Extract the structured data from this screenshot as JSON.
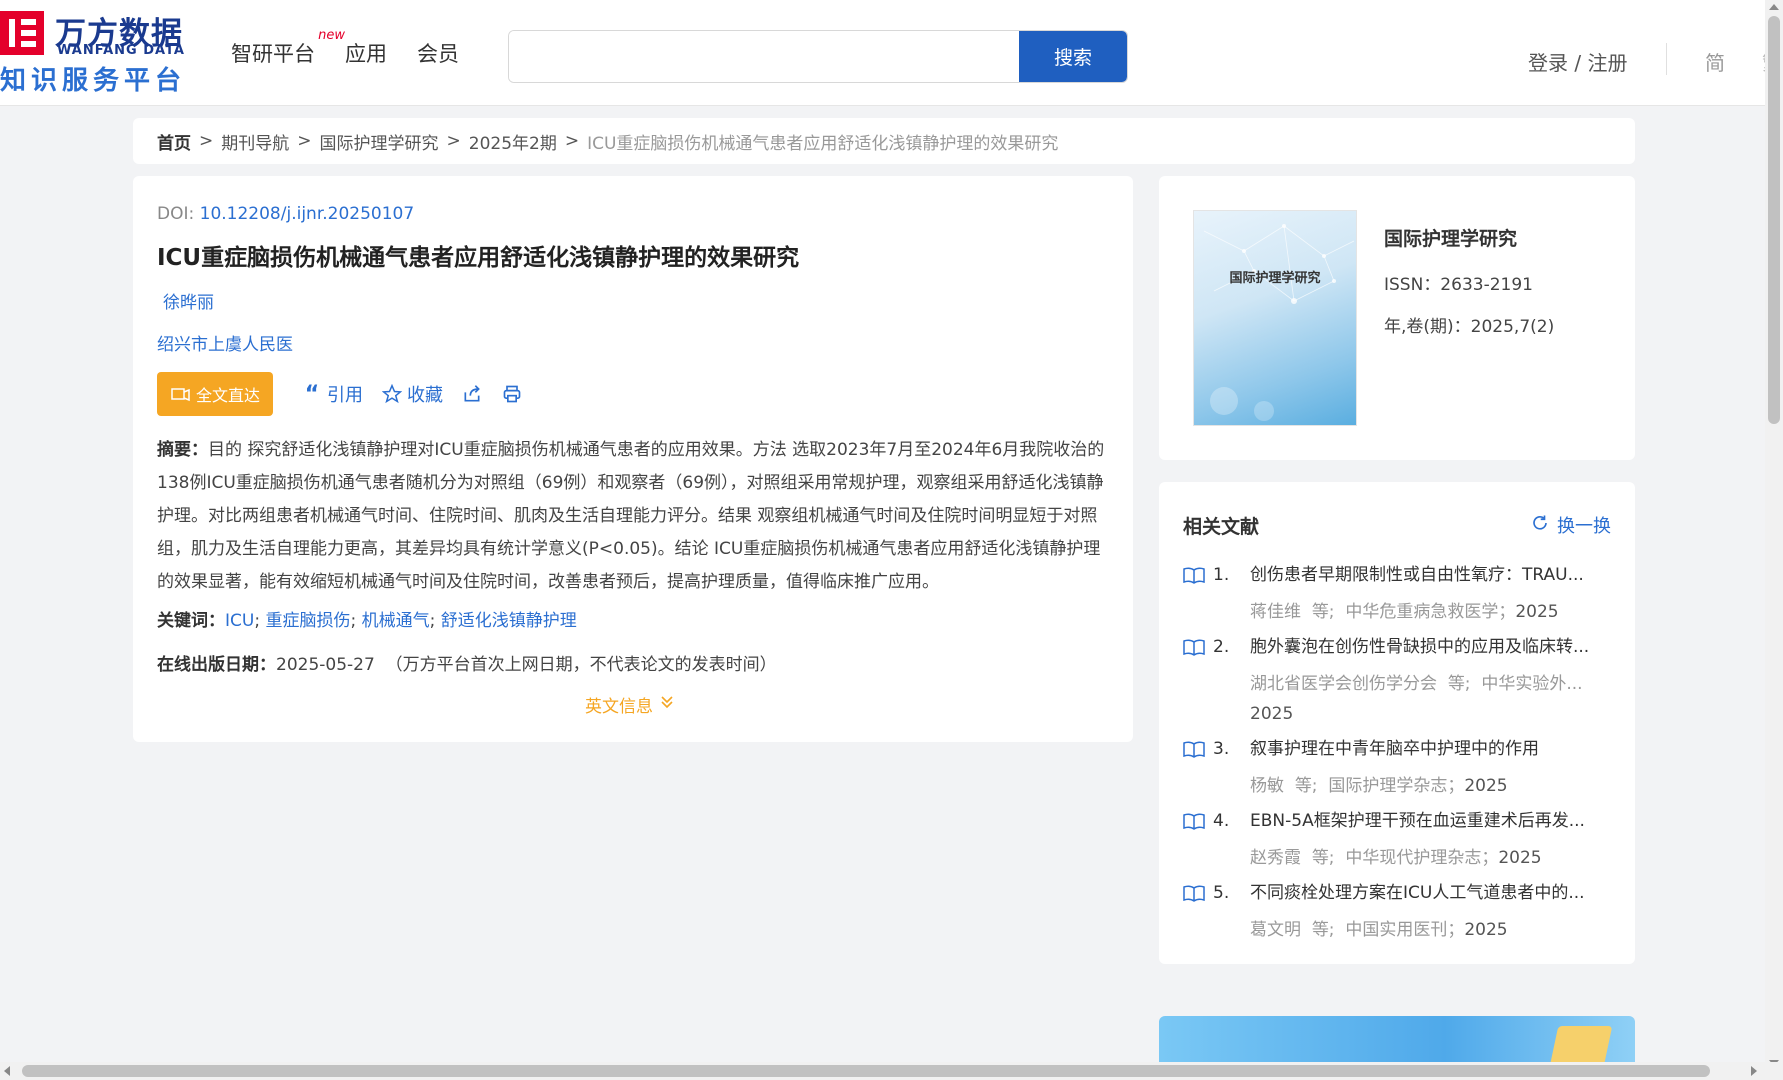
{
  "logo": {
    "cn": "万方数据",
    "en": "WANFANG DATA",
    "sub": "知识服务平台"
  },
  "nav": {
    "items": [
      {
        "label": "智研平台",
        "badge": "new"
      },
      {
        "label": "应用"
      },
      {
        "label": "会员"
      }
    ]
  },
  "search": {
    "value": "",
    "placeholder": "",
    "button_label": "搜索"
  },
  "header_right": {
    "login": "登录 / 注册",
    "lang_simplified": "简",
    "lang_traditional": "繁"
  },
  "breadcrumb": {
    "items": [
      "首页",
      "期刊导航",
      "国际护理学研究",
      "2025年2期"
    ],
    "separator": ">",
    "current": "ICU重症脑损伤机械通气患者应用舒适化浅镇静护理的效果研究"
  },
  "article": {
    "doi_label": "DOI: ",
    "doi": "10.12208/j.ijnr.20250107",
    "title": "ICU重症脑损伤机械通气患者应用舒适化浅镇静护理的效果研究",
    "author": "徐晔丽",
    "organization": "绍兴市上虞人民医",
    "actions": {
      "fulltext": "全文直达",
      "cite": "引用",
      "favorite": "收藏"
    },
    "abstract_label": "摘要：",
    "abstract": "目的 探究舒适化浅镇静护理对ICU重症脑损伤机械通气患者的应用效果。方法 选取2023年7月至2024年6月我院收治的138例ICU重症脑损伤机通气患者随机分为对照组（69例）和观察者（69例），对照组采用常规护理，观察组采用舒适化浅镇静护理。对比两组患者机械通气时间、住院时间、肌肉及生活自理能力评分。结果 观察组机械通气时间及住院时间明显短于对照组，肌力及生活自理能力更高，其差异均具有统计学意义(P<0.05)。结论 ICU重症脑损伤机械通气患者应用舒适化浅镇静护理的效果显著，能有效缩短机械通气时间及住院时间，改善患者预后，提高护理质量，值得临床推广应用。",
    "keywords_label": "关键词：",
    "keywords": [
      "ICU",
      "重症脑损伤",
      "机械通气",
      "舒适化浅镇静护理"
    ],
    "keyword_separator": ";",
    "pubdate_label": "在线出版日期：",
    "pubdate": "2025-05-27",
    "pubdate_note": "（万方平台首次上网日期，不代表论文的发表时间）",
    "english_info": "英文信息"
  },
  "journal": {
    "cover_title": "国际护理学研究",
    "name": "国际护理学研究",
    "issn": "ISSN：2633-2191",
    "volume": "年,卷(期)：2025,7(2)"
  },
  "related": {
    "title": "相关文献",
    "refresh": "换一换",
    "items": [
      {
        "num": "1.",
        "title": "创伤患者早期限制性或自由性氧疗：TRAU...",
        "authors": "蒋佳维",
        "etal": "等;",
        "source": "中华危重病急救医学；",
        "year": "2025"
      },
      {
        "num": "2.",
        "title": "胞外囊泡在创伤性骨缺损中的应用及临床转...",
        "authors": "湖北省医学会创伤学分会",
        "etal": "等;",
        "source": "中华实验外...",
        "year": "2025"
      },
      {
        "num": "3.",
        "title": "叙事护理在中青年脑卒中护理中的作用",
        "authors": "杨敏",
        "etal": "等;",
        "source": "国际护理学杂志；",
        "year": "2025"
      },
      {
        "num": "4.",
        "title": "EBN-5A框架护理干预在血运重建术后再发...",
        "authors": "赵秀霞",
        "etal": "等;",
        "source": "中华现代护理杂志；",
        "year": "2025"
      },
      {
        "num": "5.",
        "title": "不同痰栓处理方案在ICU人工气道患者中的...",
        "authors": "葛文明",
        "etal": "等;",
        "source": "中国实用医刊；",
        "year": "2025"
      }
    ]
  },
  "colors": {
    "brand_red": "#e4002b",
    "brand_blue": "#1f5fc0",
    "link": "#2b6fd1",
    "accent_orange": "#f5a623"
  }
}
